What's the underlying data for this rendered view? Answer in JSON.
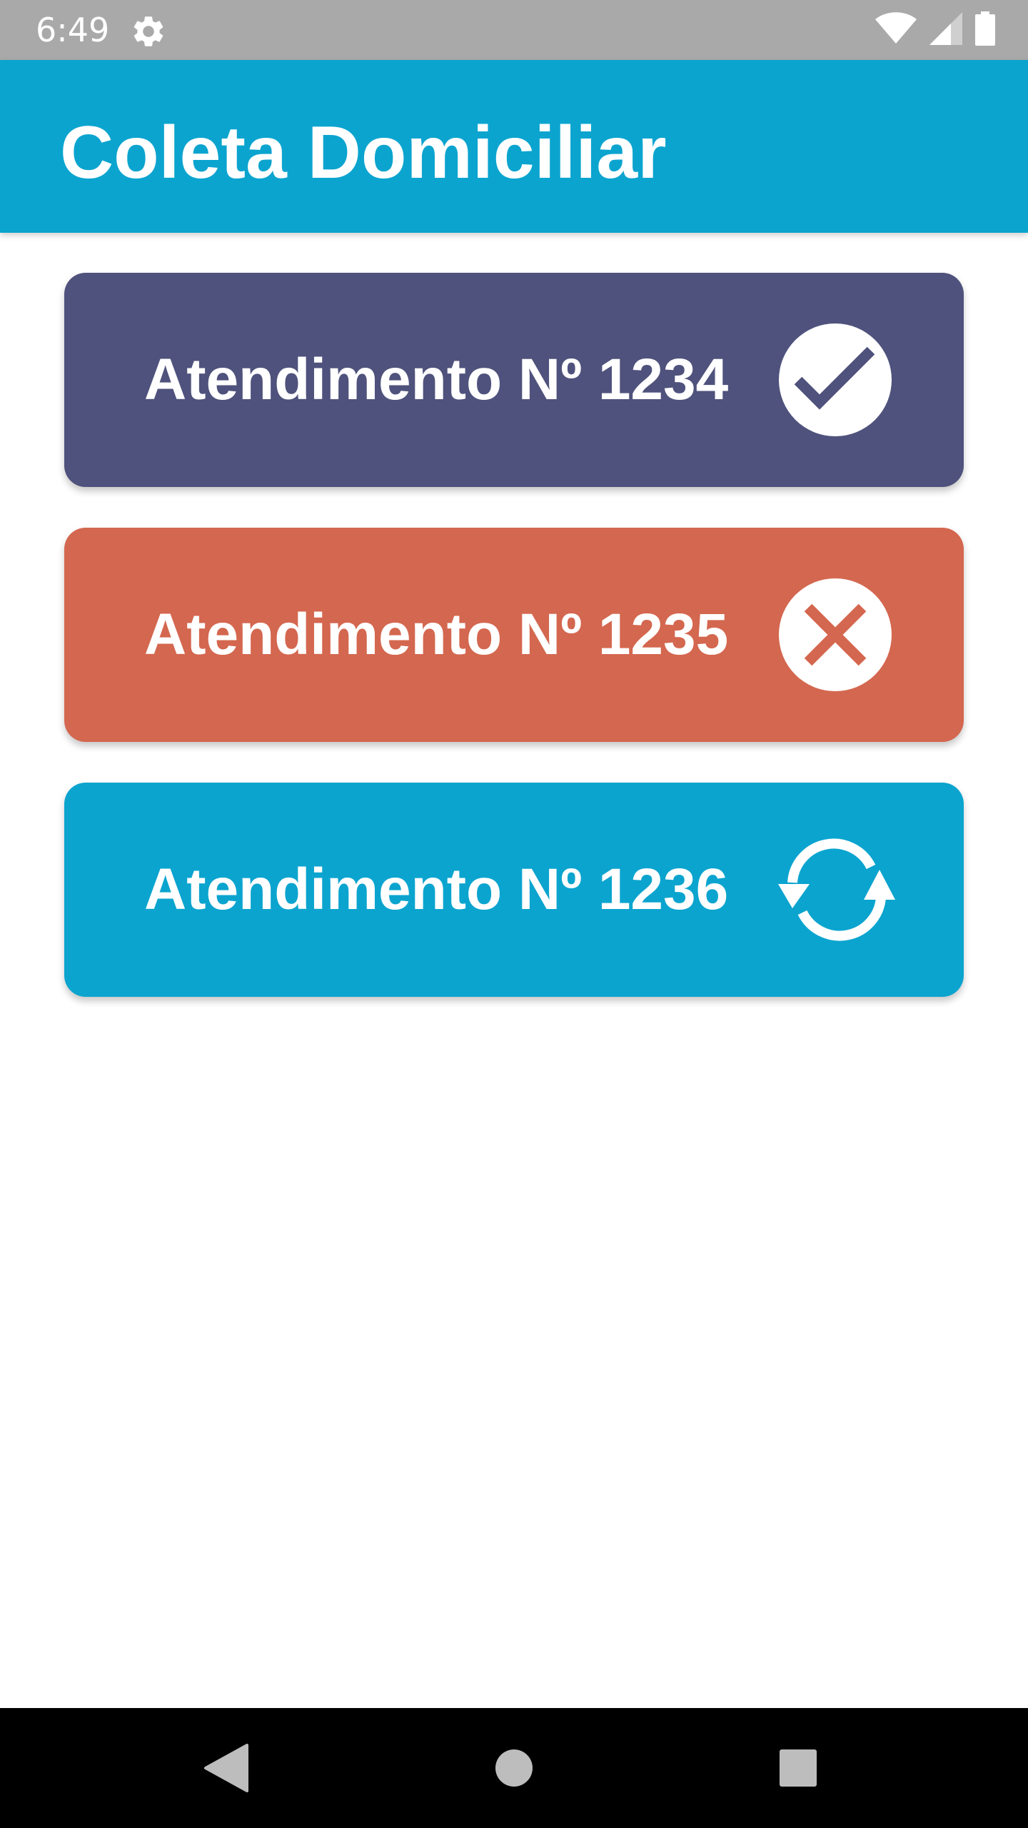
{
  "status_bar": {
    "time": "6:49",
    "settings_icon": "gear-icon",
    "wifi_icon": "wifi-icon",
    "signal_icon": "cell-signal-icon",
    "battery_icon": "battery-icon"
  },
  "app_bar": {
    "title": "Coleta Domiciliar",
    "color": "#0ba4cf"
  },
  "cards": [
    {
      "label": "Atendimento Nº 1234",
      "status": "completed",
      "icon": "check-circle-icon",
      "color": "#4f527c"
    },
    {
      "label": "Atendimento Nº 1235",
      "status": "cancelled",
      "icon": "close-circle-icon",
      "color": "#d4674f"
    },
    {
      "label": "Atendimento Nº 1236",
      "status": "in-progress",
      "icon": "sync-icon",
      "color": "#0ba4cf"
    }
  ],
  "nav_bar": {
    "back_icon": "back-triangle-icon",
    "home_icon": "home-circle-icon",
    "recents_icon": "recents-square-icon"
  }
}
